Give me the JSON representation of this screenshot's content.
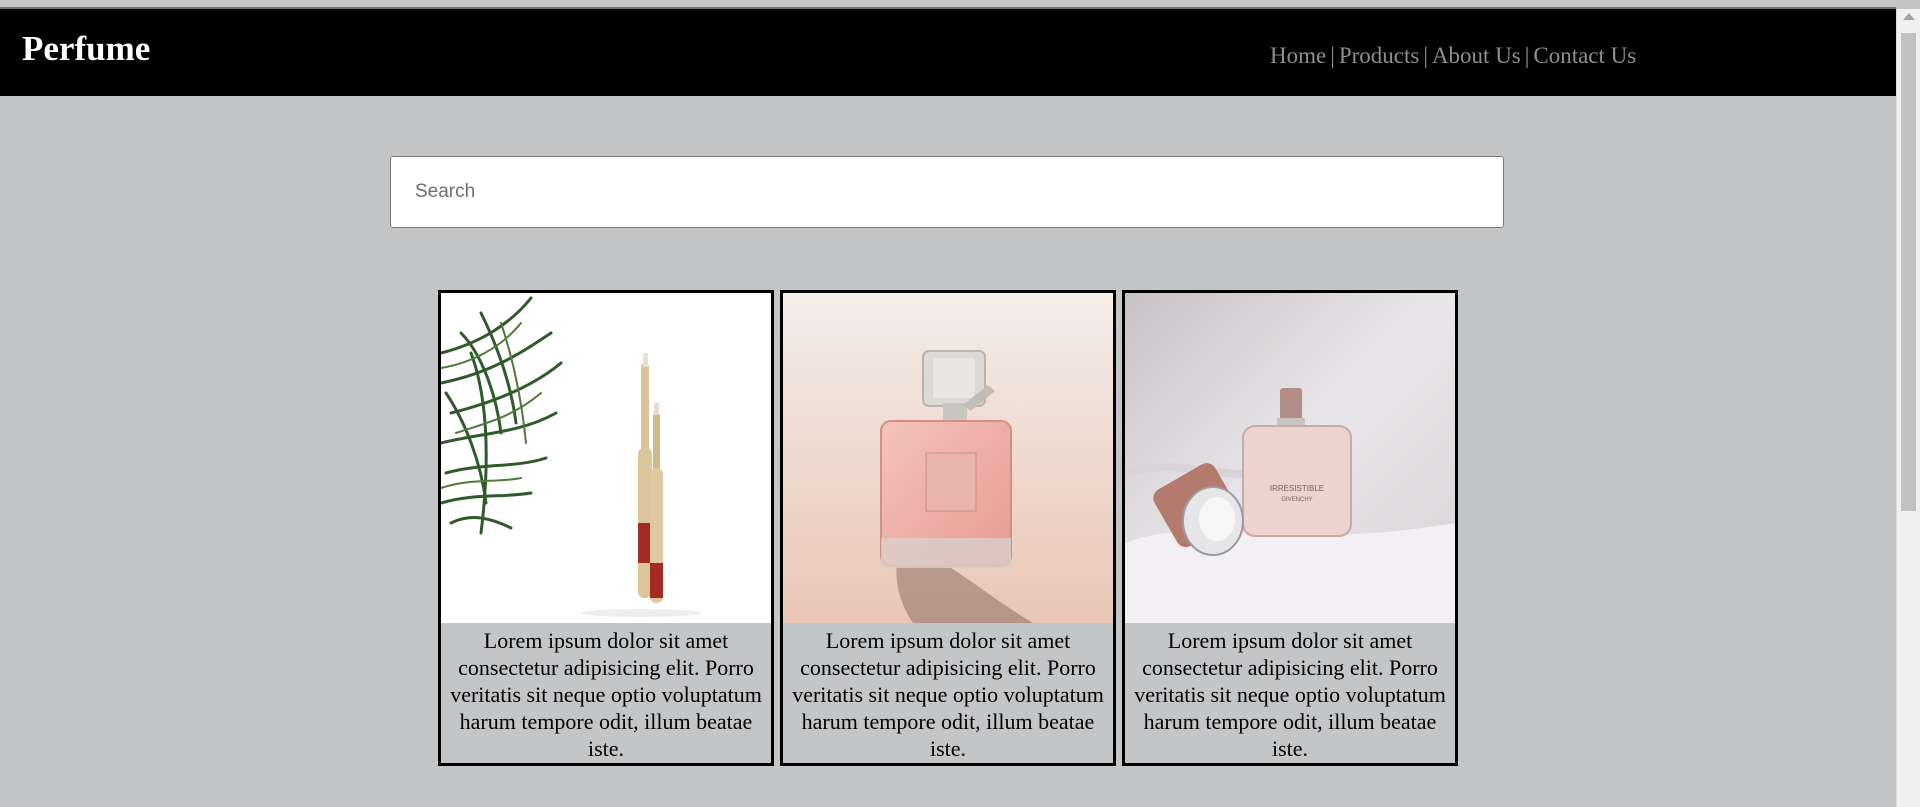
{
  "header": {
    "brand": "Perfume",
    "nav": [
      {
        "label": "Home"
      },
      {
        "label": "Products"
      },
      {
        "label": "About Us"
      },
      {
        "label": "Contact Us"
      }
    ],
    "separator": "|"
  },
  "search": {
    "placeholder": "Search",
    "value": ""
  },
  "products": [
    {
      "image": "bamboo-toothbrushes-with-grass",
      "description": "Lorem ipsum dolor sit amet consectetur adipisicing elit. Porro veritatis sit neque optio voluptatum harum tempore odit, illum beatae iste."
    },
    {
      "image": "pink-perfume-bottle",
      "description": "Lorem ipsum dolor sit amet consectetur adipisicing elit. Porro veritatis sit neque optio voluptatum harum tempore odit, illum beatae iste."
    },
    {
      "image": "irresistible-givenchy-perfume-on-fabric",
      "description": "Lorem ipsum dolor sit amet consectetur adipisicing elit. Porro veritatis sit neque optio voluptatum harum tempore odit, illum beatae iste."
    }
  ],
  "image_text": {
    "label_line1": "IRRESISTIBLE",
    "label_line2": "GIVENCHY"
  },
  "colors": {
    "page_bg": "#c4c5c7",
    "navbar_bg": "#000000",
    "nav_link": "#8f8f8f"
  }
}
